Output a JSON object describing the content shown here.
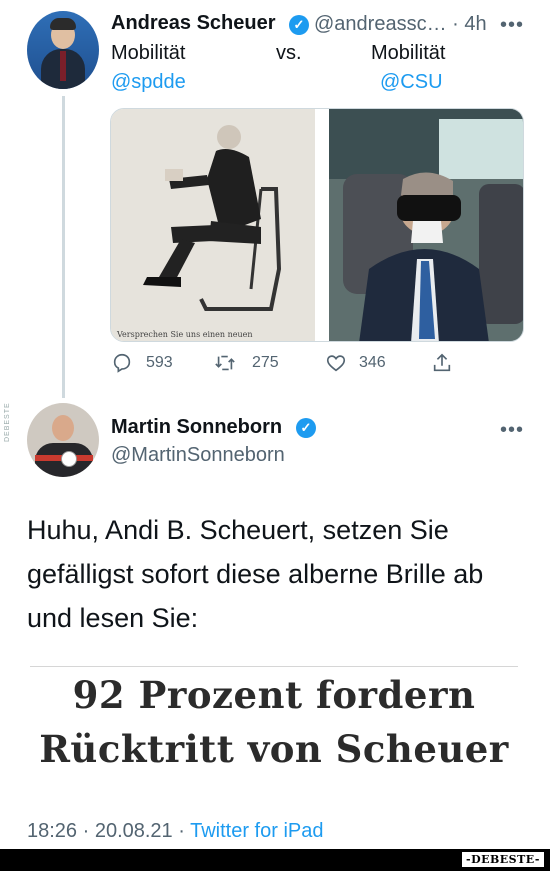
{
  "tweet1": {
    "name": "Andreas Scheuer",
    "handle": "@andreassc…",
    "time": "· 4h",
    "more": "•••",
    "line1_left": "Mobilität",
    "line1_mid": "vs.",
    "line1_right": "Mobilität",
    "line2_left": "@spdde",
    "line2_right": "@CSU",
    "media_caption": "Versprechen Sie uns einen neuen",
    "reply_count": "593",
    "retweet_count": "275",
    "like_count": "346"
  },
  "tweet2": {
    "name": "Martin Sonneborn",
    "handle": "@MartinSonneborn",
    "more": "•••",
    "text": "Huhu, Andi B. Scheuert, setzen Sie gefälligst sofort diese alberne Brille ab und lesen Sie:",
    "headline_line1": "92 Prozent fordern",
    "headline_line2": "Rücktritt von Scheuer",
    "time_date": "18:26 · 20.08.21 · ",
    "client": "Twitter for iPad"
  },
  "watermark": "-DEBESTE-",
  "side_watermark": "DEBESTE",
  "colors": {
    "link": "#1d9bf0",
    "secondary": "#536471",
    "text": "#0f1419"
  }
}
